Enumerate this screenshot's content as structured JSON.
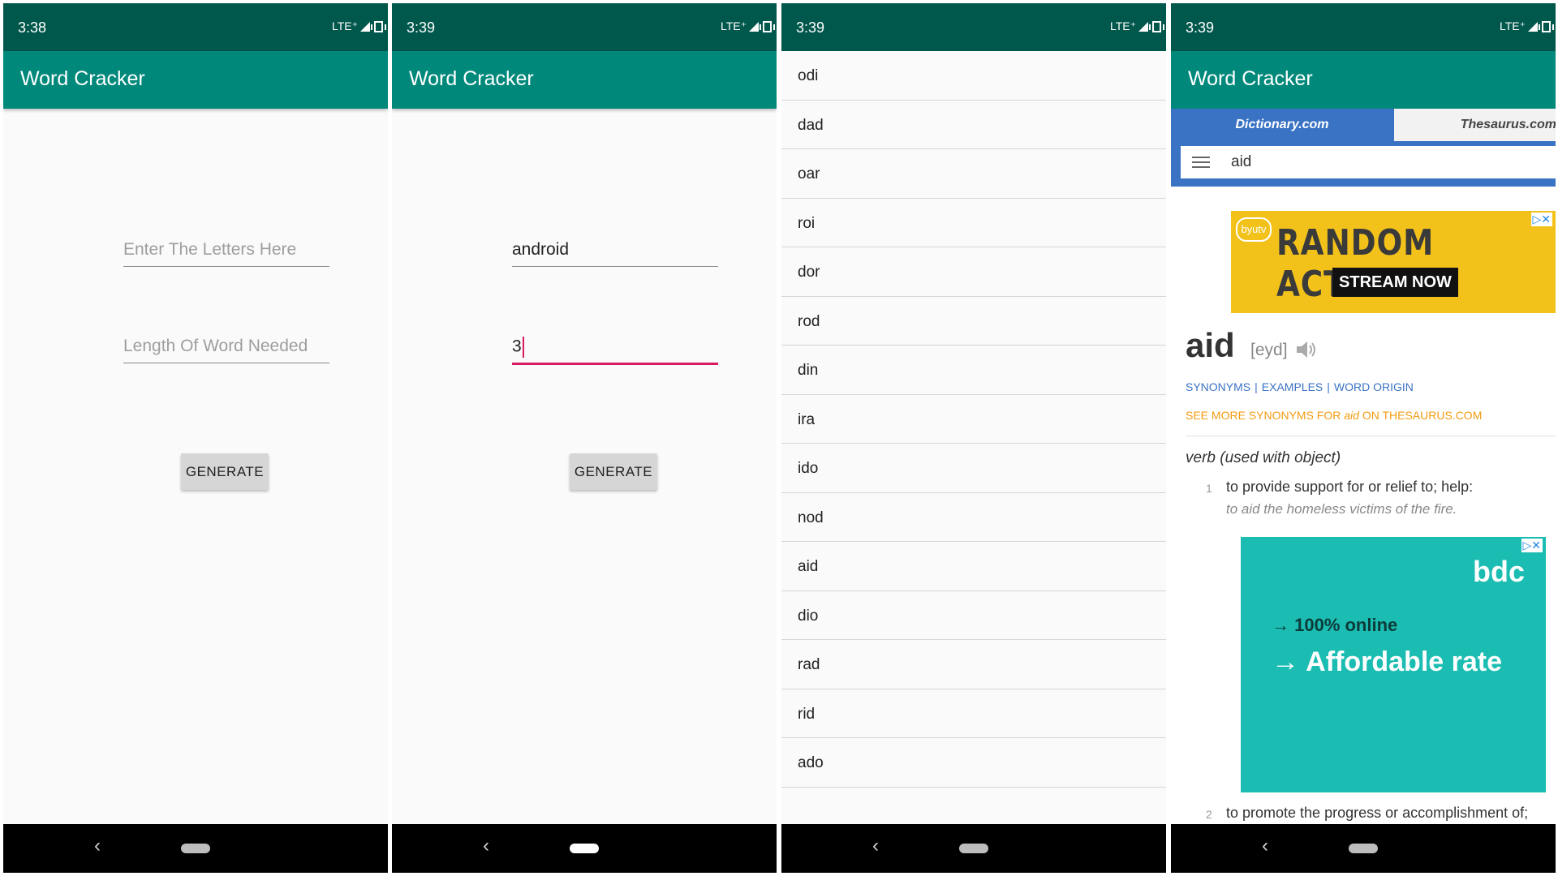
{
  "app": {
    "title": "Word Cracker"
  },
  "screens": [
    {
      "status": {
        "time": "3:38",
        "network": "LTE⁺"
      },
      "letters_field": {
        "value": "",
        "placeholder": "Enter The Letters Here"
      },
      "length_field": {
        "value": "",
        "placeholder": "Length Of Word Needed"
      },
      "generate_label": "GENERATE"
    },
    {
      "status": {
        "time": "3:39",
        "network": "LTE⁺"
      },
      "letters_field": {
        "value": "android",
        "placeholder": "Enter The Letters Here"
      },
      "length_field": {
        "value": "3",
        "placeholder": "Length Of Word Needed"
      },
      "generate_label": "GENERATE"
    },
    {
      "status": {
        "time": "3:39",
        "network": "LTE⁺"
      },
      "words": [
        "odi",
        "dad",
        "oar",
        "roi",
        "dor",
        "rod",
        "din",
        "ira",
        "ido",
        "nod",
        "aid",
        "dio",
        "rad",
        "rid",
        "ado"
      ]
    },
    {
      "status": {
        "time": "3:39",
        "network": "LTE⁺"
      },
      "tabs": [
        "Dictionary.com",
        "Thesaurus.com"
      ],
      "search": {
        "value": "aid"
      },
      "ad1": {
        "brand": "byutv",
        "headline": "RANDOM ACTS",
        "cta": "STREAM NOW"
      },
      "entry": {
        "word": "aid",
        "pronunciation": "[eyd]",
        "links": [
          "SYNONYMS",
          "EXAMPLES",
          "WORD ORIGIN"
        ],
        "see_more_prefix": "SEE MORE SYNONYMS FOR ",
        "see_more_word": "aid",
        "see_more_suffix": " ON THESAURUS.COM",
        "part_of_speech": "verb (used with object)",
        "definitions": [
          {
            "num": "1",
            "text": "to provide support for or relief to; help:",
            "example": "to aid the homeless victims of the fire."
          },
          {
            "num": "2",
            "text": "to promote the progress or accomplishment of;",
            "example": ""
          }
        ]
      },
      "ad2": {
        "brand": "bdc",
        "line1": "→ 100% online",
        "line2": "→ Affordable rate"
      }
    }
  ],
  "colors": {
    "status_bar": "#00574b",
    "app_bar": "#00897b",
    "accent": "#d81b60",
    "dict_blue": "#3a72c4",
    "ad_teal": "#1bbdb2",
    "ad_yellow": "#f2c21b"
  },
  "icons": [
    "lte-signal-icon",
    "vibrate-icon",
    "back-icon",
    "home-icon",
    "menu-icon",
    "speaker-icon",
    "ad-choices-icon"
  ]
}
